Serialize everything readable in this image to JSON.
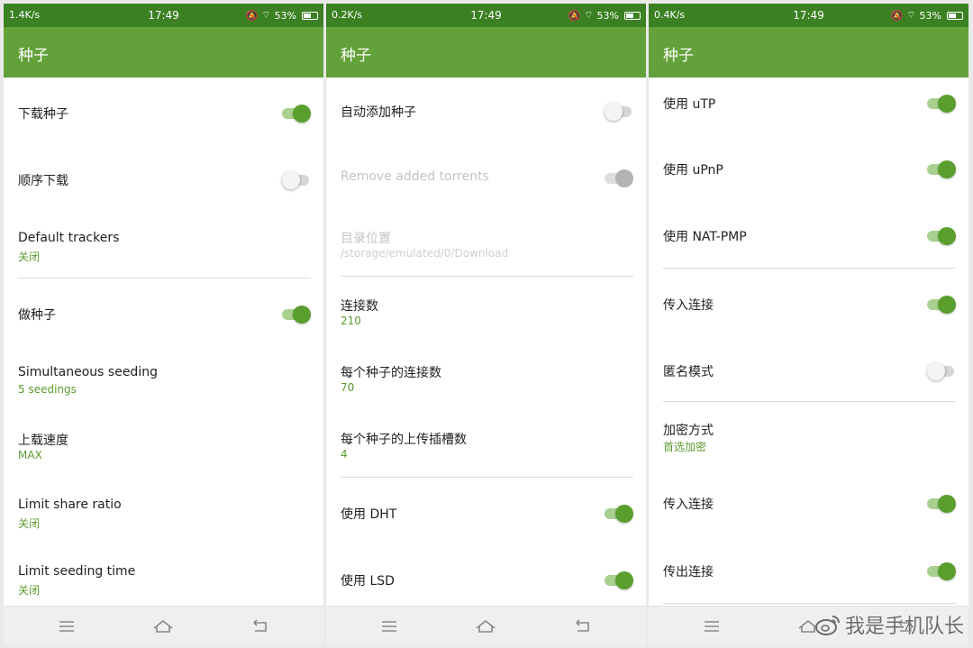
{
  "screens": [
    {
      "status": {
        "speed": "1.4K/s",
        "time": "17:49",
        "battery": "53%"
      },
      "app_title": "种子",
      "rows": [
        {
          "title": "下载种子",
          "switch": "on"
        },
        {
          "title": "顺序下载",
          "switch": "off"
        },
        {
          "title": "Default trackers",
          "subtitle": "关闭"
        },
        {
          "title": "做种子",
          "switch": "on"
        },
        {
          "title": "Simultaneous seeding",
          "subtitle": "5 seedings"
        },
        {
          "title": "上载速度",
          "subtitle": "MAX"
        },
        {
          "title": "Limit share ratio",
          "subtitle": "关闭"
        },
        {
          "title": "Limit seeding time",
          "subtitle": "关闭"
        }
      ]
    },
    {
      "status": {
        "speed": "0.2K/s",
        "time": "17:49",
        "battery": "53%"
      },
      "app_title": "种子",
      "rows": [
        {
          "title": "自动添加种子",
          "switch": "off"
        },
        {
          "title": "Remove added torrents",
          "switch": "disabled"
        },
        {
          "title": "目录位置",
          "subtitle": "/storage/emulated/0/Download"
        },
        {
          "title": "连接数",
          "subtitle": "210"
        },
        {
          "title": "每个种子的连接数",
          "subtitle": "70"
        },
        {
          "title": "每个种子的上传插槽数",
          "subtitle": "4"
        },
        {
          "title": "使用 DHT",
          "switch": "on"
        },
        {
          "title": "使用 LSD",
          "switch": "on"
        }
      ]
    },
    {
      "status": {
        "speed": "0.4K/s",
        "time": "17:49",
        "battery": "53%"
      },
      "app_title": "种子",
      "rows": [
        {
          "title": "使用 uTP",
          "switch": "on"
        },
        {
          "title": "使用 uPnP",
          "switch": "on"
        },
        {
          "title": "使用 NAT-PMP",
          "switch": "on"
        },
        {
          "title": "传入连接",
          "switch": "on"
        },
        {
          "title": "匿名模式",
          "switch": "off"
        },
        {
          "title": "加密方式",
          "subtitle": "首选加密"
        },
        {
          "title": "传入连接",
          "switch": "on"
        },
        {
          "title": "传出连接",
          "switch": "on"
        }
      ]
    }
  ],
  "watermark": "我是手机队长",
  "colors": {
    "status_bar": "#3b8123",
    "app_bar": "#63a23a",
    "accent": "#5a9e2e",
    "subtitle": "#5b9a2e"
  }
}
